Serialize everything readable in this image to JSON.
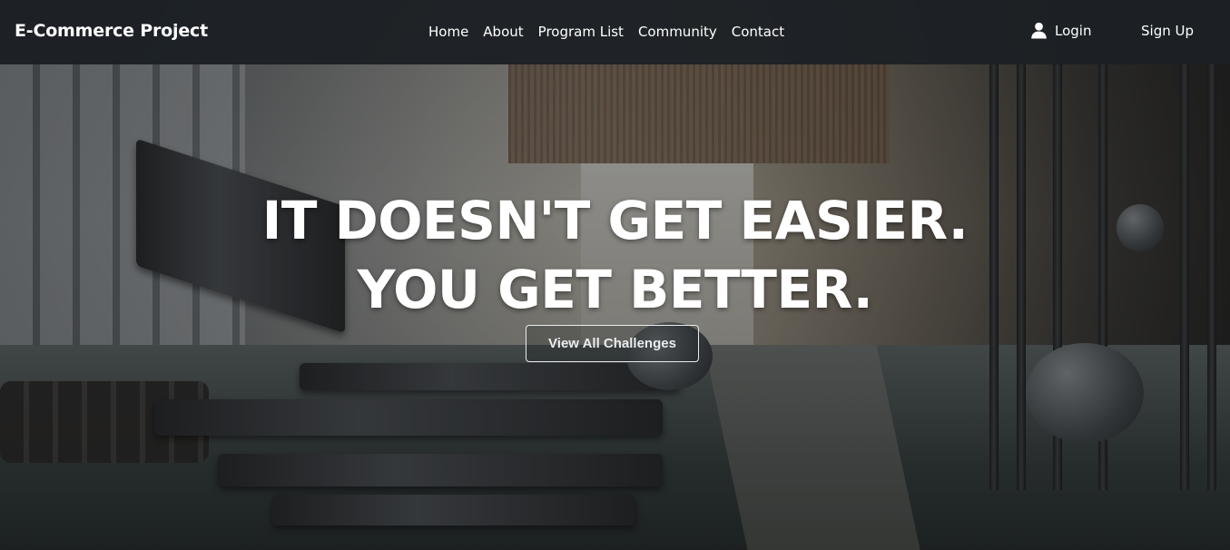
{
  "navbar": {
    "brand": "E-Commerce Project",
    "links": [
      {
        "label": "Home"
      },
      {
        "label": "About"
      },
      {
        "label": "Program List"
      },
      {
        "label": "Community"
      },
      {
        "label": "Contact"
      }
    ],
    "login_icon": "user-icon",
    "login_label": "Login",
    "signup_label": "Sign Up"
  },
  "hero": {
    "headline_line1": "IT DOESN'T GET EASIER.",
    "headline_line2": "YOU GET BETTER.",
    "cta_label": "View All Challenges",
    "background_image": "gym-interior-treadmills"
  },
  "colors": {
    "navbar_bg": "#1c2024",
    "text": "#ffffff",
    "cta_border": "#e9ecef"
  }
}
